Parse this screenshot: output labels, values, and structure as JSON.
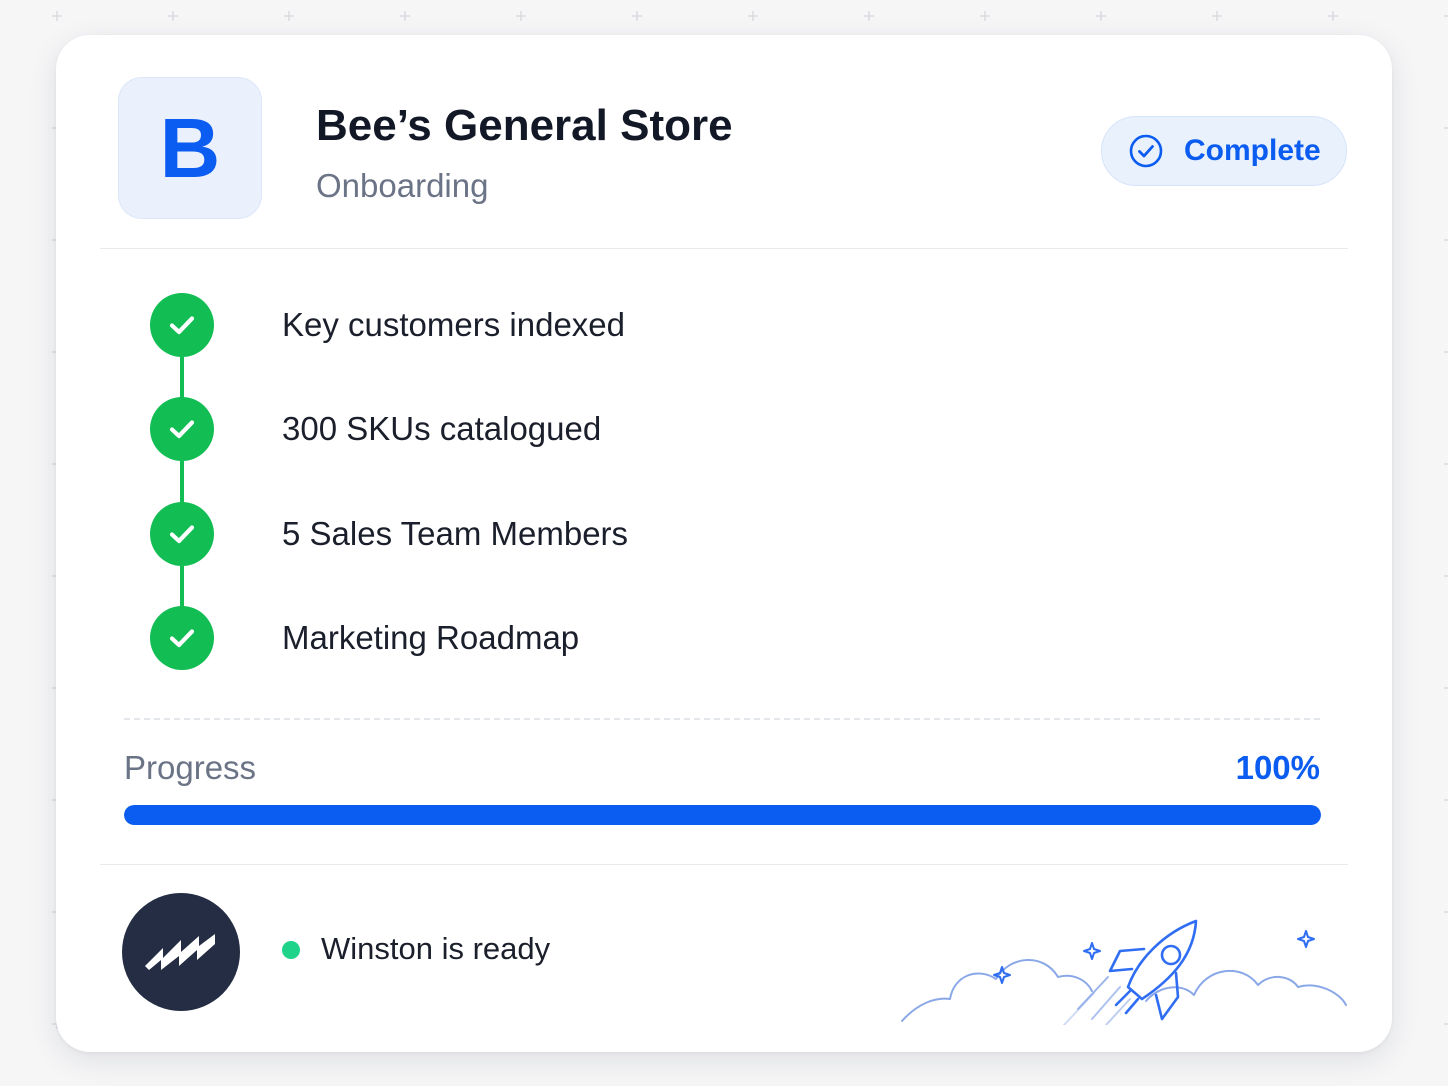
{
  "store": {
    "logo_letter": "B",
    "name": "Bee’s General Store",
    "subtitle": "Onboarding"
  },
  "status_pill": {
    "label": "Complete",
    "icon": "check-circle-icon"
  },
  "steps": [
    {
      "label": "Key customers indexed",
      "done": true,
      "icon": "check-icon"
    },
    {
      "label": "300 SKUs catalogued",
      "done": true,
      "icon": "check-icon"
    },
    {
      "label": "5 Sales Team Members",
      "done": true,
      "icon": "check-icon"
    },
    {
      "label": "Marketing Roadmap",
      "done": true,
      "icon": "check-icon"
    }
  ],
  "progress": {
    "label": "Progress",
    "value_text": "100%",
    "fraction": 1.0
  },
  "assistant": {
    "avatar_icon": "zigzag-logo-icon",
    "status_text": "Winston is ready"
  },
  "illustration": {
    "icon": "rocket-clouds-icon"
  },
  "colors": {
    "accent": "#0b5cf0",
    "success": "#12bd53",
    "ready_dot": "#1fd38a",
    "avatar_bg": "#252d44"
  }
}
